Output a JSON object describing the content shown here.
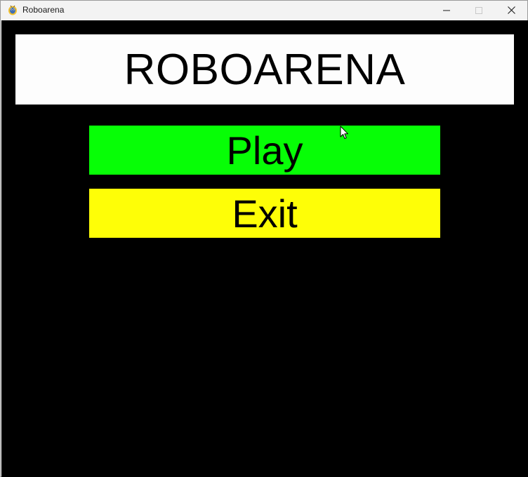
{
  "window": {
    "title": "Roboarena",
    "app_icon": "pygame-snake-icon",
    "controls": [
      "minimize-icon",
      "maximize-icon",
      "close-icon"
    ]
  },
  "game": {
    "heading": "ROBOARENA",
    "buttons": {
      "play_label": "Play",
      "exit_label": "Exit"
    }
  },
  "colors": {
    "background": "#000000",
    "title_panel": "#fdfdfd",
    "play_button": "#07fe06",
    "exit_button": "#fefe07"
  }
}
